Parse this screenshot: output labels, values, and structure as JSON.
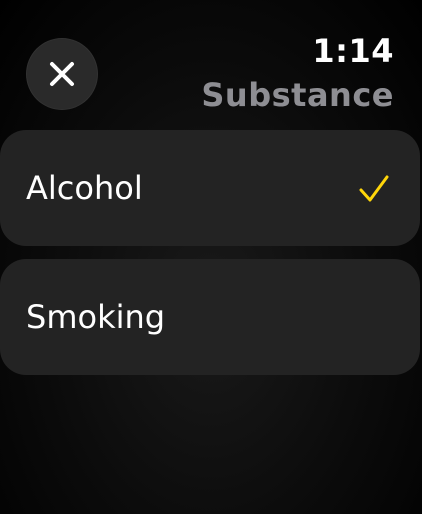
{
  "status": {
    "time": "1:14"
  },
  "header": {
    "title": "Substance"
  },
  "close_button": {
    "icon": "close-icon"
  },
  "options": [
    {
      "label": "Alcohol",
      "selected": true,
      "check_icon": "checkmark-icon"
    },
    {
      "label": "Smoking",
      "selected": false
    }
  ],
  "colors": {
    "background": "#000000",
    "card": "#232323",
    "close_button_bg": "#2a2a2a",
    "title": "#8e8e93",
    "accent_check": "#ffd60a"
  }
}
